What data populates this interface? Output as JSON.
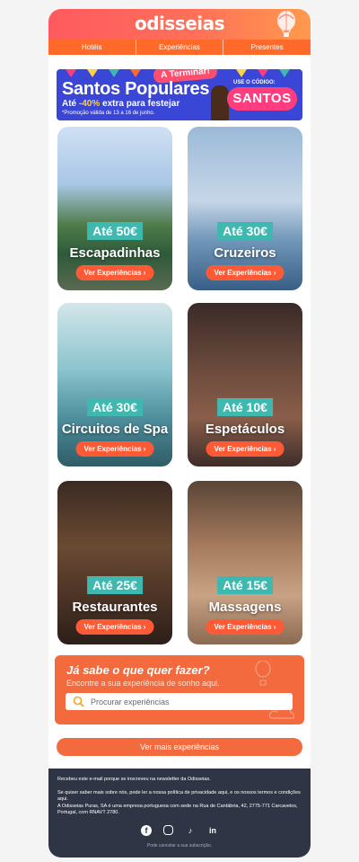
{
  "header": {
    "logo": "odisseias",
    "nav": [
      "Hotéis",
      "Experiências",
      "Presentes"
    ]
  },
  "banner": {
    "tag": "A Terminar!",
    "title": "Santos Populares",
    "subtitle_prefix": "Até",
    "subtitle_highlight": "-40%",
    "subtitle_suffix": "extra para festejar",
    "note": "*Promoção válida de 13 a 16 de junho.",
    "code_label": "USE O CÓDIGO:",
    "code": "SANTOS"
  },
  "cards": [
    {
      "price": "Até 50€",
      "name": "Escapadinhas",
      "cta": "Ver Experiências ›"
    },
    {
      "price": "Até 30€",
      "name": "Cruzeiros",
      "cta": "Ver Experiências ›"
    },
    {
      "price": "Até 30€",
      "name": "Circuitos de Spa",
      "cta": "Ver Experiências ›"
    },
    {
      "price": "Até 10€",
      "name": "Espetáculos",
      "cta": "Ver Experiências ›"
    },
    {
      "price": "Até 25€",
      "name": "Restaurantes",
      "cta": "Ver Experiências ›"
    },
    {
      "price": "Até 15€",
      "name": "Massagens",
      "cta": "Ver Experiências ›"
    }
  ],
  "search": {
    "title": "Já sabe o que quer fazer?",
    "subtitle": "Encontre a sua experiência de sonho aqui.",
    "placeholder": "Procurar experiências"
  },
  "more_button": "Ver mais experiências",
  "footer": {
    "line1": "Recebeu este e-mail porque se inscreveu na newsletter da Odisseias.",
    "line2": "Se quiser saber mais sobre nós, pode ler a nossa política de privacidade aqui, e os nossos termos e condições aqui.",
    "line3": "A Odisseias Puras, SA é uma empresa portuguesa com sede na Rua de Cantábria, 42, 2775-771 Carcavelos, Portugal, com RNAVT 2780.",
    "social": [
      "facebook-icon",
      "instagram-icon",
      "tiktok-icon",
      "linkedin-icon"
    ],
    "social_labels": [
      "f",
      "",
      "♪",
      "in"
    ],
    "cancel": "Pode cancelar a sua subscrição."
  },
  "colors": {
    "header_gradient_start": "#ff5a5f",
    "nav_orange": "#ff6a2a",
    "price_teal": "#3fb8b0",
    "cta_orange": "#ff5a36",
    "footer_navy": "#2f3544"
  }
}
